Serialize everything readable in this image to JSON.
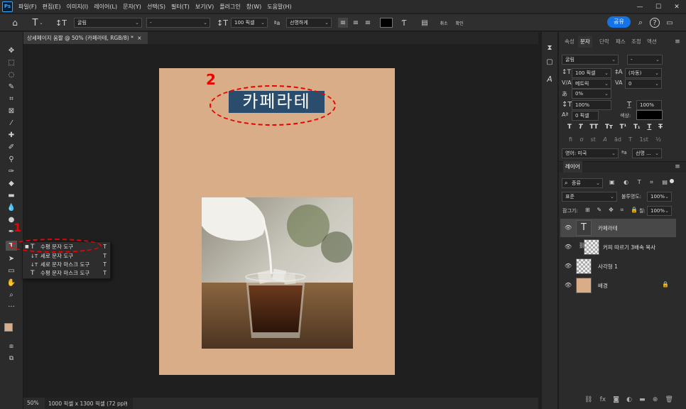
{
  "menubar": {
    "logo": "Ps",
    "items": [
      "파일(F)",
      "편집(E)",
      "이미지(I)",
      "레이어(L)",
      "문자(Y)",
      "선택(S)",
      "필터(T)",
      "보기(V)",
      "플러그인",
      "창(W)",
      "도움말(H)"
    ],
    "window_buttons": [
      "—",
      "☐",
      "✕"
    ]
  },
  "options": {
    "font_family": "굴림",
    "font_style": "-",
    "font_size": "100 픽셀",
    "aa_label": "ªa",
    "antialias": "선명하게",
    "share": "공유",
    "warp_text": "워프",
    "extra": "취소",
    "commit": "확인"
  },
  "document": {
    "tab_title": "상세페이지 움짤 @ 50% (카페라테, RGB/8) *",
    "tab_close": "×",
    "canvas_text": "카페라테",
    "canvas_color": "#d8ad88",
    "selection_color": "#2a4d6e"
  },
  "annotations": {
    "step1": "1",
    "step2": "2"
  },
  "flyout": {
    "items": [
      {
        "icon": "T",
        "label": "수평 문자 도구",
        "shortcut": "T",
        "active": true
      },
      {
        "icon": "↓T",
        "label": "세로 문자 도구",
        "shortcut": "T",
        "active": false
      },
      {
        "icon": "↓T",
        "label": "세로 문자 마스크 도구",
        "shortcut": "T",
        "active": false
      },
      {
        "icon": "T",
        "label": "수평 문자 마스크 도구",
        "shortcut": "T",
        "active": false
      }
    ]
  },
  "status": {
    "zoom": "50%",
    "info": "1000 픽셀 x 1300 픽셀 (72 ppi)",
    "arrow": "›"
  },
  "char_panel": {
    "tabs": [
      "속성",
      "문자",
      "단락",
      "패스",
      "조정",
      "액션"
    ],
    "font_family": "굴림",
    "font_style": "-",
    "size": "100 픽셀",
    "leading": "(자동)",
    "kerning": "메트릭",
    "tracking": "0",
    "tsume": "0%",
    "vscale": "100%",
    "hscale": "100%",
    "baseline": "0 픽셀",
    "color_label": "색상:",
    "color": "#000000",
    "style_buttons": [
      "T",
      "T",
      "TT",
      "Tт",
      "T¹",
      "T₁",
      "T",
      "T"
    ],
    "ot_buttons": [
      "fi",
      "ơ",
      "st",
      "A",
      "ād",
      "T",
      "1st",
      "½"
    ],
    "language": "영어: 미국",
    "aa_label": "ªa",
    "antialias": "선명 ..."
  },
  "layers_panel": {
    "title": "레이어",
    "filter": "종류",
    "blend": "표준",
    "opacity_label": "불투명도:",
    "opacity": "100%",
    "lock_label": "잠그기:",
    "fill_label": "칠:",
    "fill": "100%",
    "layers": [
      {
        "name": "카페라테",
        "type": "text"
      },
      {
        "name": "커피 따르기 3배속 복사",
        "type": "smart"
      },
      {
        "name": "사각형 1",
        "type": "shape"
      },
      {
        "name": "배경",
        "type": "background"
      }
    ]
  },
  "colors": {
    "accent": "#1473e6",
    "foreground": "#d8ad88",
    "background": "#f3e8c8",
    "annotation": "#e00000"
  }
}
